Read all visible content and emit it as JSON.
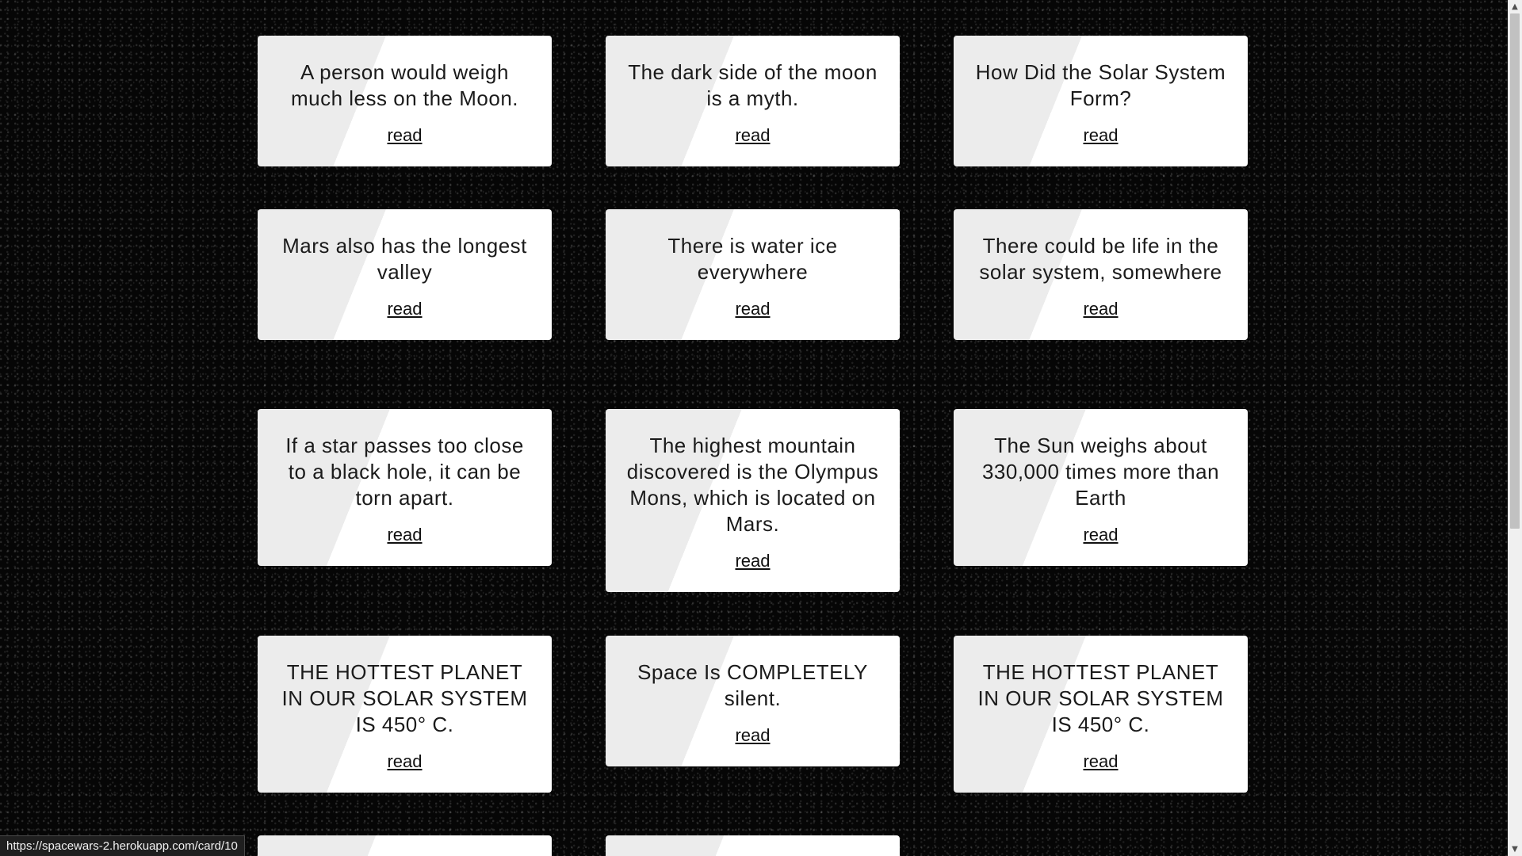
{
  "cards": [
    {
      "text": "A person would weigh much less on the Moon.",
      "link": "read"
    },
    {
      "text": "The dark side of the moon is a myth.",
      "link": "read"
    },
    {
      "text": "How Did the Solar System Form?",
      "link": "read"
    },
    {
      "text": "Mars also has the longest valley",
      "link": "read"
    },
    {
      "text": "There is water ice everywhere",
      "link": "read"
    },
    {
      "text": "There could be life in the solar system, somewhere",
      "link": "read"
    },
    {
      "text": "If a star passes too close to a black hole, it can be torn apart.",
      "link": "read"
    },
    {
      "text": "The highest mountain discovered is the Olympus Mons, which is located on Mars.",
      "link": "read"
    },
    {
      "text": "The Sun weighs about 330,000 times more than Earth",
      "link": "read"
    },
    {
      "text": "THE HOTTEST PLANET IN OUR SOLAR SYSTEM IS 450° C.",
      "link": "read"
    },
    {
      "text": "Space Is COMPLETELY silent.",
      "link": "read"
    },
    {
      "text": "THE HOTTEST PLANET IN OUR SOLAR SYSTEM IS 450° C.",
      "link": "read"
    }
  ],
  "status_bar": {
    "url": "https://spacewars-2.herokuapp.com/card/10"
  },
  "scrollbar": {
    "up_icon": "▲",
    "down_icon": "▼"
  }
}
